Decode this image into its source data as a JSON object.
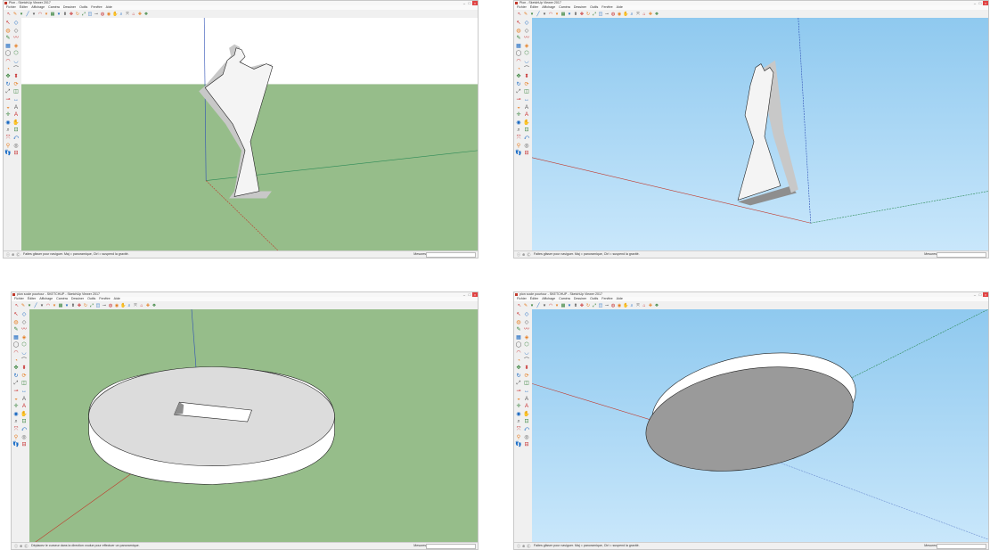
{
  "colors": {
    "ground_green": "#96bd8a",
    "sky_white": "#ffffff",
    "sky_blue": "#8fc9ef",
    "sky_blue_light": "#c9e7fb",
    "shape_face": "#f4f4f4",
    "shape_side": "#c8c8c8",
    "axis_red": "#c0392b",
    "axis_green": "#2e8b57",
    "axis_blue": "#2d4fb5",
    "close_button": "#e04343"
  },
  "windows": [
    {
      "title": "Pion - SketchUp Viewer 2017",
      "menu": [
        "Fichier",
        "Éditer",
        "Affichage",
        "Caméra",
        "Dessiner",
        "Outils",
        "Fenêtre",
        "Aide"
      ],
      "view": "figure-over-ground",
      "status_hint": "Faites glisser pour naviguer. Maj = panoramique, Ctrl = suspend la gravité.",
      "measures_label": "Mesures"
    },
    {
      "title": "Pion - SketchUp Viewer 2017",
      "menu": [
        "Fichier",
        "Éditer",
        "Affichage",
        "Caméra",
        "Dessiner",
        "Outils",
        "Fenêtre",
        "Aide"
      ],
      "view": "figure-from-below",
      "status_hint": "Faites glisser pour naviguer. Maj = panoramique, Ctrl = suspend la gravité.",
      "measures_label": "Mesures"
    },
    {
      "title": "pion socle pourtour - SKETCHUP - SketchUp Viewer 2017",
      "menu": [
        "Fichier",
        "Éditer",
        "Affichage",
        "Caméra",
        "Dessiner",
        "Outils",
        "Fenêtre",
        "Aide"
      ],
      "view": "base-top",
      "status_hint": "Déplacez le curseur dans la direction voulue pour effectuer un panoramique.",
      "measures_label": "Mesures"
    },
    {
      "title": "pion socle pourtour - SKETCHUP - SketchUp Viewer 2017",
      "menu": [
        "Fichier",
        "Éditer",
        "Affichage",
        "Caméra",
        "Dessiner",
        "Outils",
        "Fenêtre",
        "Aide"
      ],
      "view": "base-bottom",
      "status_hint": "Faites glisser pour naviguer. Maj = panoramique, Ctrl = suspend la gravité.",
      "measures_label": "Mesures"
    }
  ],
  "toolbar_icons": [
    "select-icon",
    "pencil-icon",
    "dropdown-icon",
    "line-icon",
    "dropdown-icon",
    "arc-icon",
    "dropdown-icon",
    "rectangle-icon",
    "dropdown-icon",
    "push-pull-icon",
    "move-icon",
    "rotate-icon",
    "scale-icon",
    "offset-icon",
    "tape-measure-icon",
    "paint-bucket-icon",
    "orbit-icon",
    "pan-icon",
    "zoom-icon",
    "zoom-extents-icon",
    "warehouse-icon",
    "extension-icon",
    "components-icon"
  ],
  "side_icons": [
    "select-icon",
    "eraser-icon",
    "paint-bucket-icon",
    "eraser-icon",
    "pencil-icon",
    "freehand-icon",
    "rectangle-icon",
    "rotated-rectangle-icon",
    "circle-icon",
    "polygon-icon",
    "arc-icon",
    "arc2-icon",
    "pie-icon",
    "arc3-icon",
    "move-icon",
    "push-pull-icon",
    "rotate-icon",
    "follow-me-icon",
    "scale-icon",
    "offset-icon",
    "tape-measure-icon",
    "dimension-icon",
    "protractor-icon",
    "text-icon",
    "axes-icon",
    "3d-text-icon",
    "orbit-icon",
    "pan-icon",
    "zoom-icon",
    "zoom-window-icon",
    "zoom-extents-icon",
    "previous-icon",
    "position-camera-icon",
    "look-around-icon",
    "walk-icon",
    "section-icon"
  ]
}
